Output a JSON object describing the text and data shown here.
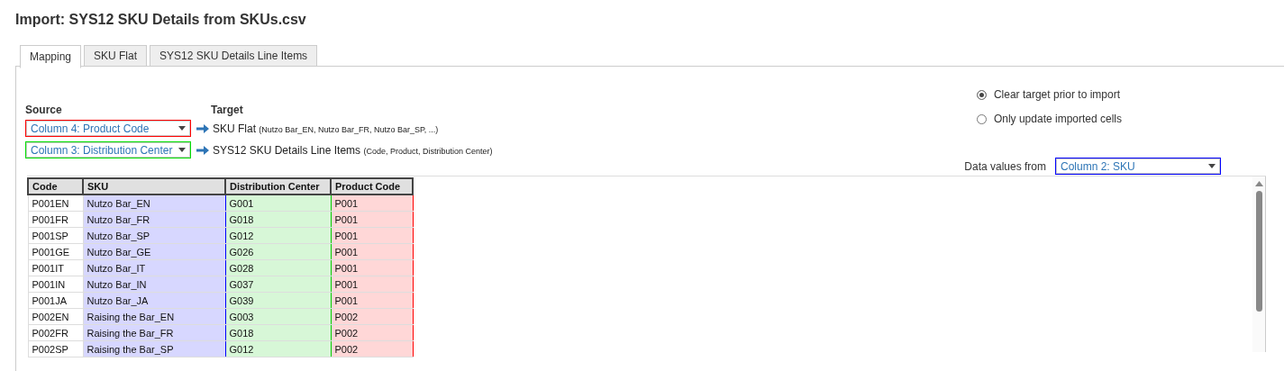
{
  "title": "Import: SYS12 SKU Details from SKUs.csv",
  "tabs": [
    {
      "label": "Mapping",
      "selected": true
    },
    {
      "label": "SKU Flat",
      "selected": false
    },
    {
      "label": "SYS12 SKU Details Line Items",
      "selected": false
    }
  ],
  "source_label": "Source",
  "target_label": "Target",
  "mappings": [
    {
      "source": "Column 4: Product Code",
      "color": "#ff0000",
      "target": "SKU Flat",
      "target_detail": "(Nutzo Bar_EN, Nutzo Bar_FR, Nutzo Bar_SP, ...)"
    },
    {
      "source": "Column 3: Distribution Center",
      "color": "#00dd00",
      "target": "SYS12 SKU Details Line Items",
      "target_detail": "(Code, Product, Distribution Center)"
    }
  ],
  "options": [
    {
      "label": "Clear target prior to import",
      "selected": true
    },
    {
      "label": "Only update imported cells",
      "selected": false
    }
  ],
  "data_values": {
    "label": "Data values from",
    "value": "Column 2: SKU",
    "color": "#0000ff"
  },
  "grid": {
    "columns": [
      {
        "name": "Code"
      },
      {
        "name": "SKU",
        "color": "#0000ff"
      },
      {
        "name": "Distribution Center",
        "color": "#00cc00"
      },
      {
        "name": "Product Code",
        "color": "#ff0000"
      }
    ],
    "rows": [
      [
        "P001EN",
        "Nutzo Bar_EN",
        "G001",
        "P001"
      ],
      [
        "P001FR",
        "Nutzo Bar_FR",
        "G018",
        "P001"
      ],
      [
        "P001SP",
        "Nutzo Bar_SP",
        "G012",
        "P001"
      ],
      [
        "P001GE",
        "Nutzo Bar_GE",
        "G026",
        "P001"
      ],
      [
        "P001IT",
        "Nutzo Bar_IT",
        "G028",
        "P001"
      ],
      [
        "P001IN",
        "Nutzo Bar_IN",
        "G037",
        "P001"
      ],
      [
        "P001JA",
        "Nutzo Bar_JA",
        "G039",
        "P001"
      ],
      [
        "P002EN",
        "Raising the Bar_EN",
        "G003",
        "P002"
      ],
      [
        "P002FR",
        "Raising the Bar_FR",
        "G018",
        "P002"
      ],
      [
        "P002SP",
        "Raising the Bar_SP",
        "G012",
        "P002"
      ]
    ]
  }
}
